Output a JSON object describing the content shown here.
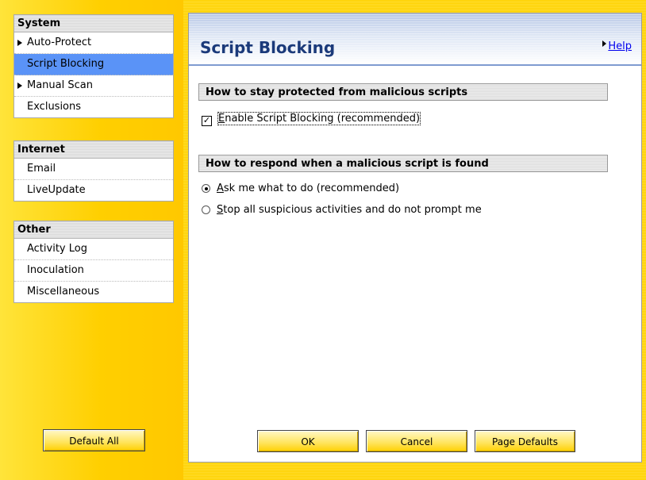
{
  "sidebar": {
    "groups": [
      {
        "title": "System",
        "items": [
          {
            "label": "Auto-Protect",
            "arrow": true
          },
          {
            "label": "Script Blocking",
            "selected": true
          },
          {
            "label": "Manual Scan",
            "arrow": true
          },
          {
            "label": "Exclusions"
          }
        ]
      },
      {
        "title": "Internet",
        "items": [
          {
            "label": "Email"
          },
          {
            "label": "LiveUpdate"
          }
        ]
      },
      {
        "title": "Other",
        "items": [
          {
            "label": "Activity Log"
          },
          {
            "label": "Inoculation"
          },
          {
            "label": "Miscellaneous"
          }
        ]
      }
    ],
    "default_all_label": "Default All"
  },
  "main": {
    "title": "Script Blocking",
    "help_label": "Help",
    "section1": {
      "header": "How to stay protected from malicious scripts",
      "checkbox_key": "E",
      "checkbox_rest": "nable Script Blocking (recommended)",
      "checked": true
    },
    "section2": {
      "header": "How to respond when a malicious script is found",
      "radio1_key": "A",
      "radio1_rest": "sk me what to do (recommended)",
      "radio1_selected": true,
      "radio2_key": "S",
      "radio2_rest": "top all suspicious activities and do not prompt me",
      "radio2_selected": false
    },
    "buttons": {
      "ok": "OK",
      "cancel": "Cancel",
      "page_defaults": "Page Defaults"
    }
  },
  "colors": {
    "selected_item": "#5a93f7",
    "background_yellow": "#ffd200",
    "title_blue": "#1b3a7a"
  }
}
